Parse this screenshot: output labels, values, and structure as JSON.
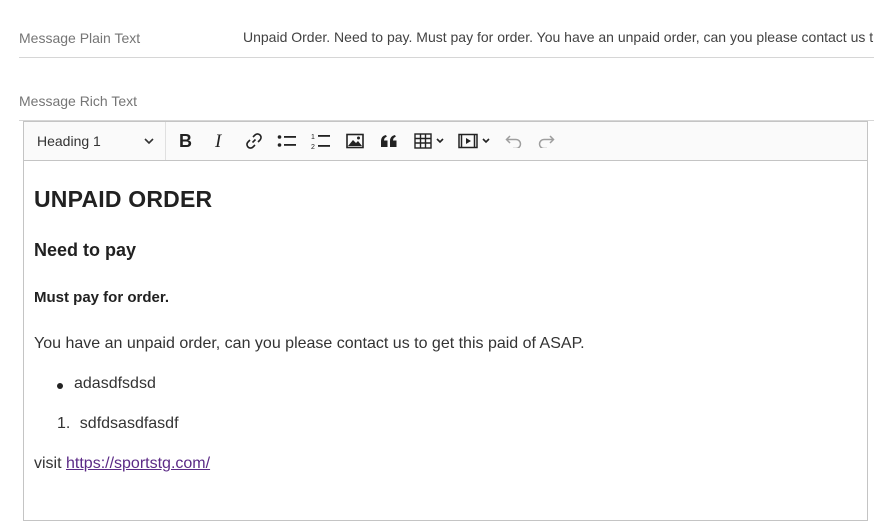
{
  "plain_field": {
    "label": "Message Plain Text",
    "value": "Unpaid Order. Need to pay. Must pay for order. You have an unpaid order, can you please contact us t"
  },
  "rich_field": {
    "label": "Message Rich Text"
  },
  "toolbar": {
    "heading_value": "Heading 1",
    "buttons": [
      "bold-icon",
      "italic-icon",
      "link-icon",
      "bulleted-list-icon",
      "numbered-list-icon",
      "image-icon",
      "blockquote-icon",
      "table-icon",
      "media-icon",
      "undo-icon",
      "redo-icon"
    ]
  },
  "content": {
    "h1": "UNPAID ORDER",
    "h2": "Need to pay",
    "h3": "Must pay for order.",
    "paragraph": "You have an unpaid order, can you please contact us to get this paid of ASAP.",
    "bullet_item": "adasdfsdsd",
    "numbered_marker": "1.",
    "numbered_item": "sdfdsasdfasdf",
    "visit_prefix": "visit ",
    "link_text": "https://sportstg.com/"
  }
}
